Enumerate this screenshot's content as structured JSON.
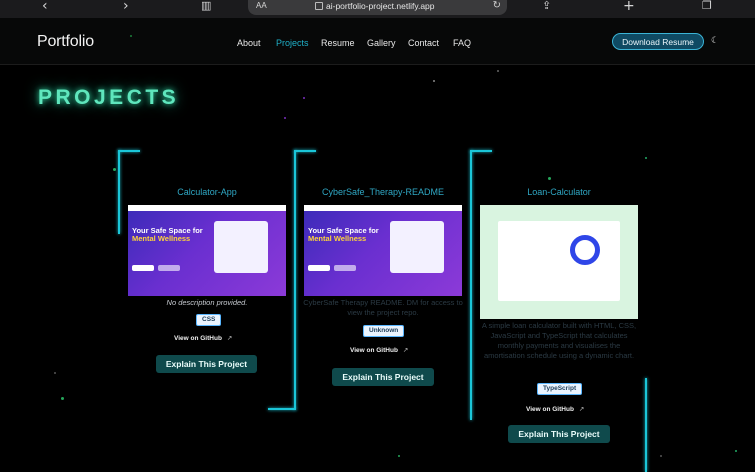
{
  "browser": {
    "back_icon": "chevron-left-icon",
    "forward_icon": "chevron-right-icon",
    "book_icon": "book-icon",
    "aa_label": "AA",
    "url": "ai-portfolio-project.netlify.app",
    "reload_icon": "reload-icon",
    "share_icon": "share-icon",
    "plus_icon": "plus-icon",
    "tabs_icon": "tabs-icon"
  },
  "nav": {
    "brand": "Portfolio",
    "links": [
      "About",
      "Projects",
      "Resume",
      "Gallery",
      "Contact",
      "FAQ"
    ],
    "active_link": "Projects",
    "download_label": "Download Resume",
    "theme_icon": "moon-icon"
  },
  "page": {
    "heading": "PROJECTS",
    "accent_color": "#5fe6bd",
    "line_color": "#1bc6d8"
  },
  "projects": [
    {
      "title": "Calculator-App",
      "thumb_heading": "Your Safe Space for Mental Wellness",
      "description": "No description provided.",
      "tag": "CSS",
      "github_label": "View on GitHub",
      "explain_label": "Explain This Project"
    },
    {
      "title": "CyberSafe_Therapy-README",
      "thumb_heading": "Your Safe Space for Mental Wellness",
      "description": "CyberSafe Therapy README. DM for access to view the project repo.",
      "tag": "Unknown",
      "github_label": "View on GitHub",
      "explain_label": "Explain This Project"
    },
    {
      "title": "Loan-Calculator",
      "description": "A simple loan calculator built with HTML, CSS, JavaScript and TypeScript that calculates monthly payments and visualises the amortisation schedule using a dynamic chart.",
      "tag": "TypeScript",
      "github_label": "View on GitHub",
      "explain_label": "Explain This Project"
    }
  ]
}
